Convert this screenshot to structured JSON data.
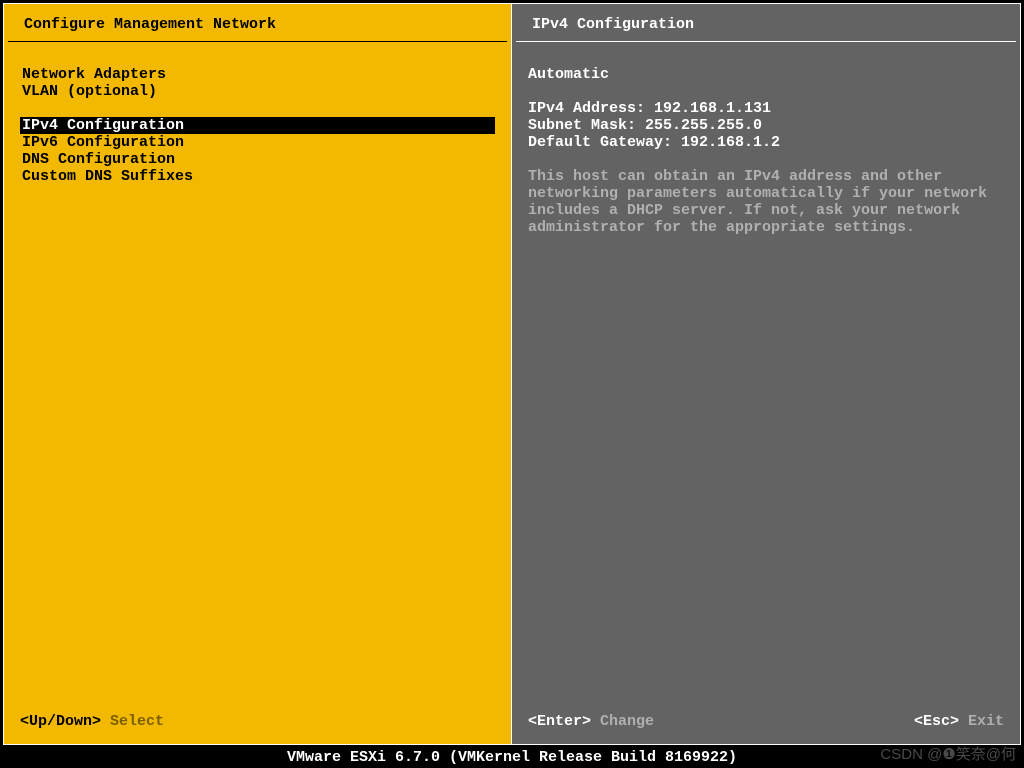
{
  "left": {
    "title": "Configure Management Network",
    "groups": [
      [
        {
          "label": "Network Adapters",
          "selected": false
        },
        {
          "label": "VLAN (optional)",
          "selected": false
        }
      ],
      [
        {
          "label": "IPv4 Configuration",
          "selected": true
        },
        {
          "label": "IPv6 Configuration",
          "selected": false
        },
        {
          "label": "DNS Configuration",
          "selected": false
        },
        {
          "label": "Custom DNS Suffixes",
          "selected": false
        }
      ]
    ],
    "footer": {
      "key": "<Up/Down>",
      "action": "Select"
    }
  },
  "right": {
    "title": "IPv4 Configuration",
    "mode": "Automatic",
    "details": [
      {
        "label": "IPv4 Address:",
        "value": "192.168.1.131"
      },
      {
        "label": "Subnet Mask:",
        "value": "255.255.255.0"
      },
      {
        "label": "Default Gateway:",
        "value": "192.168.1.2"
      }
    ],
    "help": "This host can obtain an IPv4 address and other networking parameters automatically if your network includes a DHCP server. If not, ask your network administrator for the appropriate settings.",
    "footer_left": {
      "key": "<Enter>",
      "action": "Change"
    },
    "footer_right": {
      "key": "<Esc>",
      "action": "Exit"
    }
  },
  "bottom_bar": "VMware ESXi 6.7.0 (VMKernel Release Build 8169922)",
  "watermark": "CSDN @❶笑奈@何"
}
